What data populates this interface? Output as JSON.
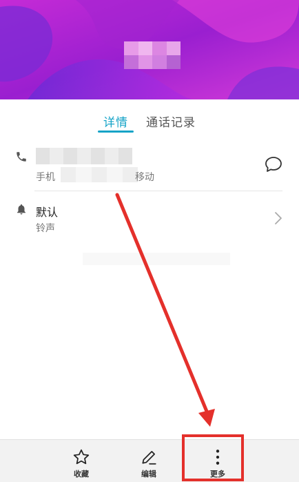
{
  "colors": {
    "accent": "#14a3c7",
    "header_background": "#9b2bd1",
    "annotation_red": "#e4302b"
  },
  "tabs": [
    {
      "label": "详情",
      "active": true
    },
    {
      "label": "通话记录",
      "active": false
    }
  ],
  "phone_row": {
    "type_label": "手机",
    "carrier_suffix": "移动",
    "icon": "phone-icon",
    "action_icon": "message-icon"
  },
  "ringtone_row": {
    "title": "默认",
    "subtitle": "铃声",
    "icon": "bell-icon",
    "action_icon": "chevron-right-icon"
  },
  "bottom_actions": [
    {
      "label": "收藏",
      "icon": "star-icon"
    },
    {
      "label": "编辑",
      "icon": "pencil-icon"
    },
    {
      "label": "更多",
      "icon": "more-vertical-icon"
    }
  ]
}
